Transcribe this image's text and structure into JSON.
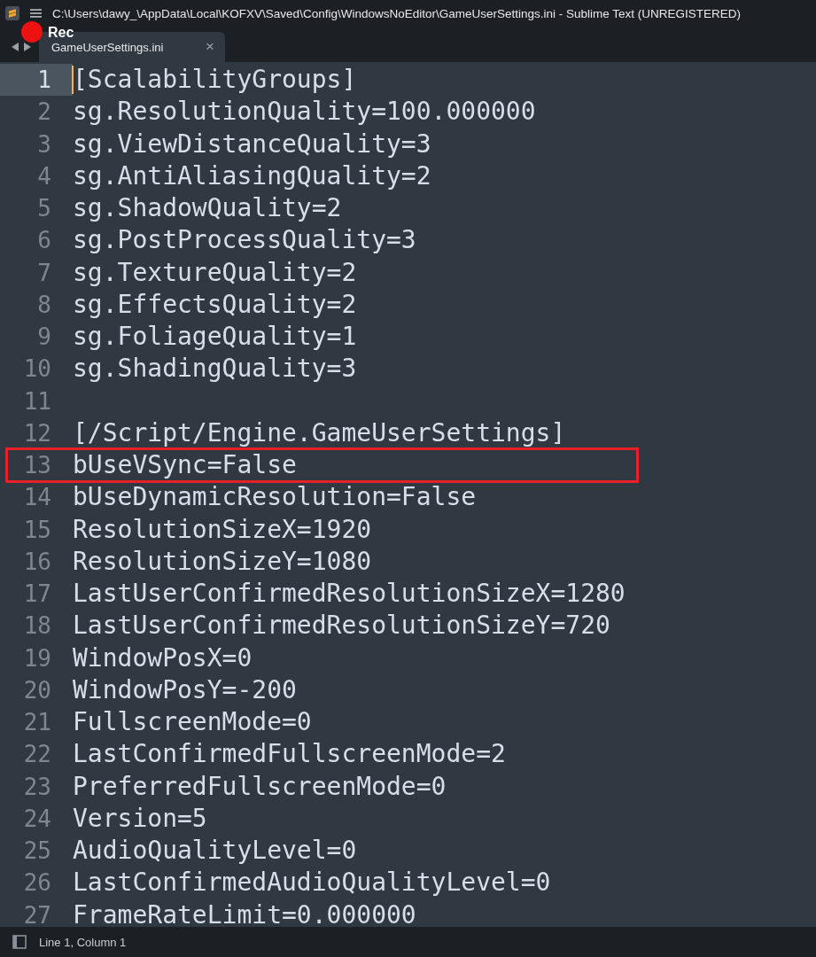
{
  "window": {
    "title": "C:\\Users\\dawy_\\AppData\\Local\\KOFXV\\Saved\\Config\\WindowsNoEditor\\GameUserSettings.ini - Sublime Text (UNREGISTERED)"
  },
  "recording": {
    "label": "Rec"
  },
  "tabs": [
    {
      "label": "GameUserSettings.ini",
      "selected": true,
      "close": "×"
    }
  ],
  "editor": {
    "lines": [
      {
        "number": "1",
        "text": "[ScalabilityGroups]",
        "current": true,
        "boxed": false
      },
      {
        "number": "2",
        "text": "sg.ResolutionQuality=100.000000",
        "current": false,
        "boxed": false
      },
      {
        "number": "3",
        "text": "sg.ViewDistanceQuality=3",
        "current": false,
        "boxed": false
      },
      {
        "number": "4",
        "text": "sg.AntiAliasingQuality=2",
        "current": false,
        "boxed": false
      },
      {
        "number": "5",
        "text": "sg.ShadowQuality=2",
        "current": false,
        "boxed": false
      },
      {
        "number": "6",
        "text": "sg.PostProcessQuality=3",
        "current": false,
        "boxed": false
      },
      {
        "number": "7",
        "text": "sg.TextureQuality=2",
        "current": false,
        "boxed": false
      },
      {
        "number": "8",
        "text": "sg.EffectsQuality=2",
        "current": false,
        "boxed": false
      },
      {
        "number": "9",
        "text": "sg.FoliageQuality=1",
        "current": false,
        "boxed": false
      },
      {
        "number": "10",
        "text": "sg.ShadingQuality=3",
        "current": false,
        "boxed": false
      },
      {
        "number": "11",
        "current": false,
        "boxed": false
      },
      {
        "number": "12",
        "text": "[/Script/Engine.GameUserSettings]",
        "current": false,
        "boxed": false
      },
      {
        "number": "13",
        "text": "bUseVSync=False",
        "current": false,
        "boxed": true
      },
      {
        "number": "14",
        "text": "bUseDynamicResolution=False",
        "current": false,
        "boxed": false
      },
      {
        "number": "15",
        "text": "ResolutionSizeX=1920",
        "current": false,
        "boxed": false
      },
      {
        "number": "16",
        "text": "ResolutionSizeY=1080",
        "current": false,
        "boxed": false
      },
      {
        "number": "17",
        "text": "LastUserConfirmedResolutionSizeX=1280",
        "current": false,
        "boxed": false
      },
      {
        "number": "18",
        "text": "LastUserConfirmedResolutionSizeY=720",
        "current": false,
        "boxed": false
      },
      {
        "number": "19",
        "text": "WindowPosX=0",
        "current": false,
        "boxed": false
      },
      {
        "number": "20",
        "text": "WindowPosY=-200",
        "current": false,
        "boxed": false
      },
      {
        "number": "21",
        "text": "FullscreenMode=0",
        "current": false,
        "boxed": false
      },
      {
        "number": "22",
        "text": "LastConfirmedFullscreenMode=2",
        "current": false,
        "boxed": false
      },
      {
        "number": "23",
        "text": "PreferredFullscreenMode=0",
        "current": false,
        "boxed": false
      },
      {
        "number": "24",
        "text": "Version=5",
        "current": false,
        "boxed": false
      },
      {
        "number": "25",
        "text": "AudioQualityLevel=0",
        "current": false,
        "boxed": false
      },
      {
        "number": "26",
        "text": "LastConfirmedAudioQualityLevel=0",
        "current": false,
        "boxed": false
      },
      {
        "number": "27",
        "text": "FrameRateLimit=0.000000",
        "current": false,
        "boxed": false
      }
    ]
  },
  "status_bar": {
    "position": "Line 1, Column 1"
  }
}
